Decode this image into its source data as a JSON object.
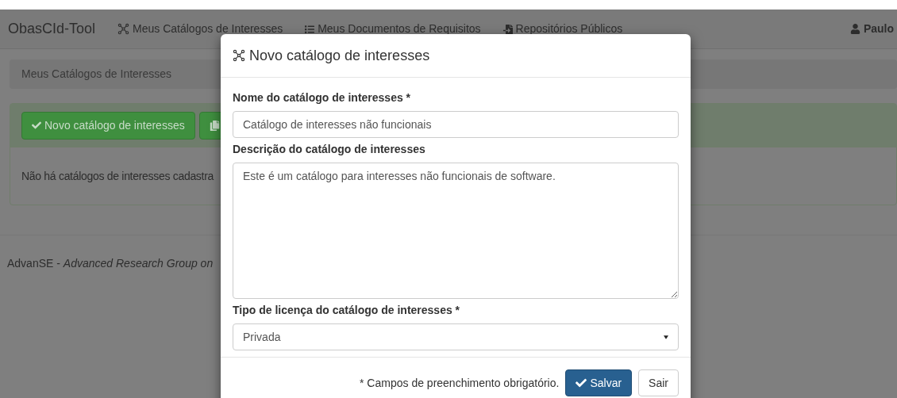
{
  "navbar": {
    "brand": "ObasCId-Tool",
    "links": [
      {
        "kind": "network",
        "label": "Meus Catálogos de Interesses"
      },
      {
        "kind": "list",
        "label": "Meus Documentos de Requisitos"
      },
      {
        "kind": "repo",
        "label": "Repositórios Públicos"
      }
    ],
    "user": "Paulo"
  },
  "breadcrumb": "Meus Catálogos de Interesses",
  "panel": {
    "buttons": [
      {
        "kind": "check",
        "label": "Novo catálogo de interesses"
      },
      {
        "kind": "copy"
      }
    ],
    "empty_message": "Não há catálogos de interesses cadastra"
  },
  "footer": {
    "org": "AdvanSE - ",
    "name": "Advanced Research Group on"
  },
  "modal": {
    "title": "Novo catálogo de interesses",
    "fields": [
      {
        "kind": "text",
        "label": "Nome do catálogo de interesses *",
        "value": "Catálogo de interesses não funcionais"
      },
      {
        "kind": "textarea",
        "label": "Descrição do catálogo de interesses",
        "value": "Este é um catálogo para interesses não funcionais de software."
      },
      {
        "kind": "select",
        "label": "Tipo de licença do catálogo de interesses *",
        "value": "Privada"
      }
    ],
    "footer_note": "* Campos de preenchimento obrigatório.",
    "buttons": [
      {
        "kind": "primary",
        "label": "Salvar"
      },
      {
        "kind": "default",
        "label": "Sair"
      }
    ]
  }
}
